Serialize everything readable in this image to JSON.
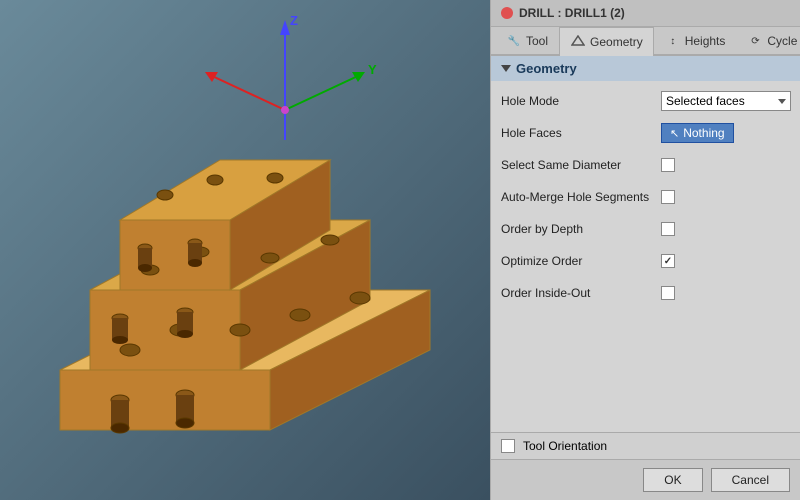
{
  "title": "DRILL : DRILL1 (2)",
  "tabs": [
    {
      "label": "Tool",
      "icon": "🔧",
      "active": false
    },
    {
      "label": "Geometry",
      "icon": "◇",
      "active": true
    },
    {
      "label": "Heights",
      "icon": "↕",
      "active": false
    },
    {
      "label": "Cycle",
      "icon": "⟳",
      "active": false
    }
  ],
  "section": {
    "title": "Geometry"
  },
  "form": {
    "hole_mode_label": "Hole Mode",
    "hole_mode_value": "Selected faces",
    "hole_faces_label": "Hole Faces",
    "hole_faces_btn": "Nothing",
    "select_same_diameter_label": "Select Same Diameter",
    "auto_merge_label": "Auto-Merge Hole Segments",
    "order_by_depth_label": "Order by Depth",
    "optimize_order_label": "Optimize Order",
    "order_inside_out_label": "Order Inside-Out"
  },
  "tool_orientation": "Tool Orientation",
  "buttons": {
    "ok": "OK",
    "cancel": "Cancel"
  },
  "checkboxes": {
    "select_same_diameter": false,
    "auto_merge": false,
    "order_by_depth": false,
    "optimize_order": true,
    "order_inside_out": false,
    "tool_orientation": false
  }
}
